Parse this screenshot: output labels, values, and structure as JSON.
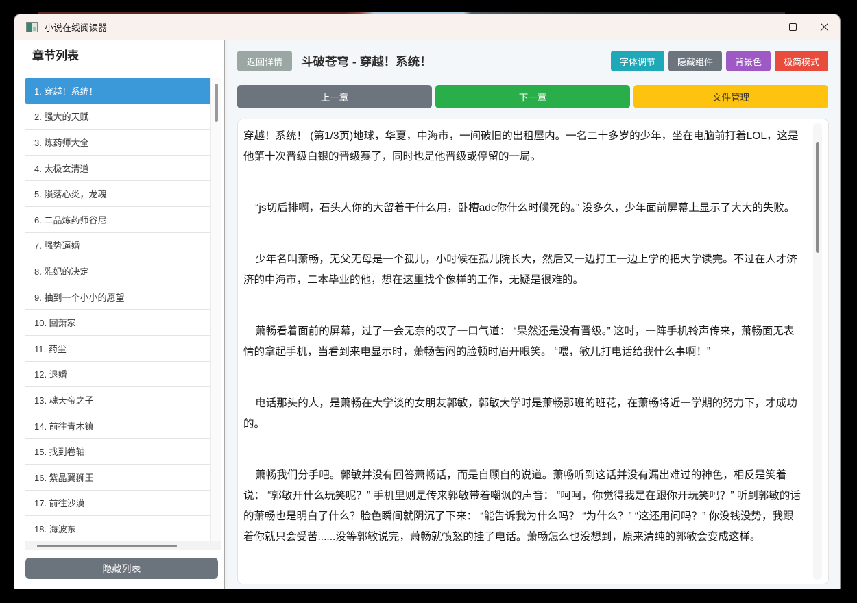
{
  "window": {
    "title": "小说在线阅读器"
  },
  "colors": {
    "selected_chapter": "#3b98d9",
    "titlebar_bg": "#f9f1ee",
    "main_panel_bg": "#f4f7fa"
  },
  "sidebar": {
    "heading": "章节列表",
    "chapters": [
      {
        "label": "1. 穿越！系统！",
        "selected": true
      },
      {
        "label": "2. 强大的天赋",
        "selected": false
      },
      {
        "label": "3. 炼药师大全",
        "selected": false
      },
      {
        "label": "4. 太极玄清道",
        "selected": false
      },
      {
        "label": "5. 陨落心炎，龙魂",
        "selected": false
      },
      {
        "label": "6. 二品炼药师谷尼",
        "selected": false
      },
      {
        "label": "7. 强势逼婚",
        "selected": false
      },
      {
        "label": "8. 雅妃的决定",
        "selected": false
      },
      {
        "label": "9. 抽到一个小小的愿望",
        "selected": false
      },
      {
        "label": "10. 回萧家",
        "selected": false
      },
      {
        "label": "11. 药尘",
        "selected": false
      },
      {
        "label": "12. 退婚",
        "selected": false
      },
      {
        "label": "13. 魂天帝之子",
        "selected": false
      },
      {
        "label": "14. 前往青木镇",
        "selected": false
      },
      {
        "label": "15. 找到卷轴",
        "selected": false
      },
      {
        "label": "16. 紫晶翼狮王",
        "selected": false
      },
      {
        "label": "17. 前往沙漠",
        "selected": false
      },
      {
        "label": "18. 海波东",
        "selected": false
      }
    ],
    "hide_button": {
      "label": "隐藏列表",
      "color": "#6b737c"
    }
  },
  "header": {
    "back": {
      "label": "返回详情",
      "color": "#9aa7a3"
    },
    "title": "斗破苍穹 - 穿越！系统！",
    "actions": [
      {
        "label": "字体调节",
        "color": "#1ea8b8",
        "name": "font-adjust-button"
      },
      {
        "label": "隐藏组件",
        "color": "#6c757d",
        "name": "hide-components-button"
      },
      {
        "label": "背景色",
        "color": "#9e59c4",
        "name": "background-color-button"
      },
      {
        "label": "极简模式",
        "color": "#e84c3d",
        "name": "minimal-mode-button"
      }
    ]
  },
  "nav": {
    "prev": {
      "label": "上一章",
      "color": "#6c757d",
      "text_color": "#ffffff"
    },
    "next": {
      "label": "下一章",
      "color": "#2aae49",
      "text_color": "#ffffff"
    },
    "files": {
      "label": "文件管理",
      "color": "#fdc30f",
      "text_color": "#333333"
    }
  },
  "reader": {
    "paragraphs": [
      "穿越！系统！ (第1/3页)地球，华夏，中海市，一间破旧的出租屋内。一名二十多岁的少年，坐在电脑前打着LOL，这是他第十次晋级白银的晋级赛了，同时也是他晋级或停留的一局。",
      "    “js切后排啊，石头人你的大留着干什么用，卧槽adc你什么时候死的。” 没多久，少年面前屏幕上显示了大大的失败。",
      "    少年名叫萧畅，无父无母是一个孤儿，小时候在孤儿院长大，然后又一边打工一边上学的把大学读完。不过在人才济济的中海市，二本毕业的他，想在这里找个像样的工作，无疑是很难的。",
      "    萧畅看着面前的屏幕，过了一会无奈的叹了一口气道： “果然还是没有晋级。” 这时，一阵手机铃声传来，萧畅面无表情的拿起手机，当看到来电显示时，萧畅苦闷的脸顿时眉开眼笑。 “喂，敏儿打电话给我什么事啊！”",
      "    电话那头的人，是萧畅在大学谈的女朋友郭敏，郭敏大学时是萧畅那班的班花，在萧畅将近一学期的努力下，才成功的。",
      "    萧畅我们分手吧。郭敏并没有回答萧畅话，而是自顾自的说道。萧畅听到这话并没有漏出难过的神色，相反是笑着说： “郭敏开什么玩笑呢？” 手机里则是传来郭敏带着嘲讽的声音： “呵呵，你觉得我是在跟你开玩笑吗？” 听到郭敏的话的萧畅也是明白了什么？脸色瞬间就阴沉了下来： “能告诉我为什么吗？ “为什么？” “这还用问吗？” 你没钱没势，我跟着你就只会受苦......没等郭敏说完，萧畅就愤怒的挂了电话。萧畅怎么也没想到，原来清纯的郭敏会变成这样。"
    ]
  }
}
